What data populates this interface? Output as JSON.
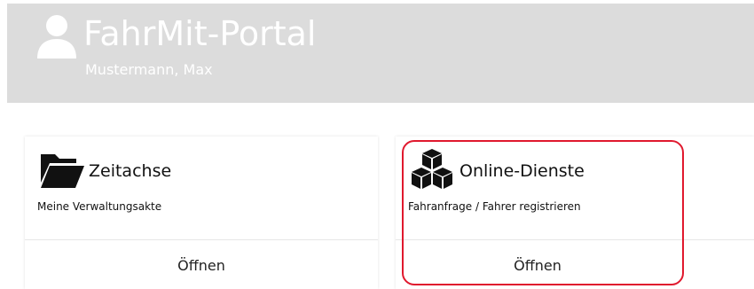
{
  "header": {
    "title": "FahrMit-Portal",
    "user_name": "Mustermann, Max",
    "icon": "user-icon",
    "background_color": "#dcdcdc",
    "text_color": "#ffffff"
  },
  "cards": [
    {
      "title": "Zeitachse",
      "description": "Meine Verwaltungsakte",
      "action_label": "Öffnen",
      "icon": "folder-open-icon"
    },
    {
      "title": "Online-Dienste",
      "description": "Fahranfrage / Fahrer registrieren",
      "action_label": "Öffnen",
      "icon": "cubes-icon"
    }
  ],
  "highlight": {
    "color": "#e0192e",
    "target": "online-dienste-card"
  }
}
